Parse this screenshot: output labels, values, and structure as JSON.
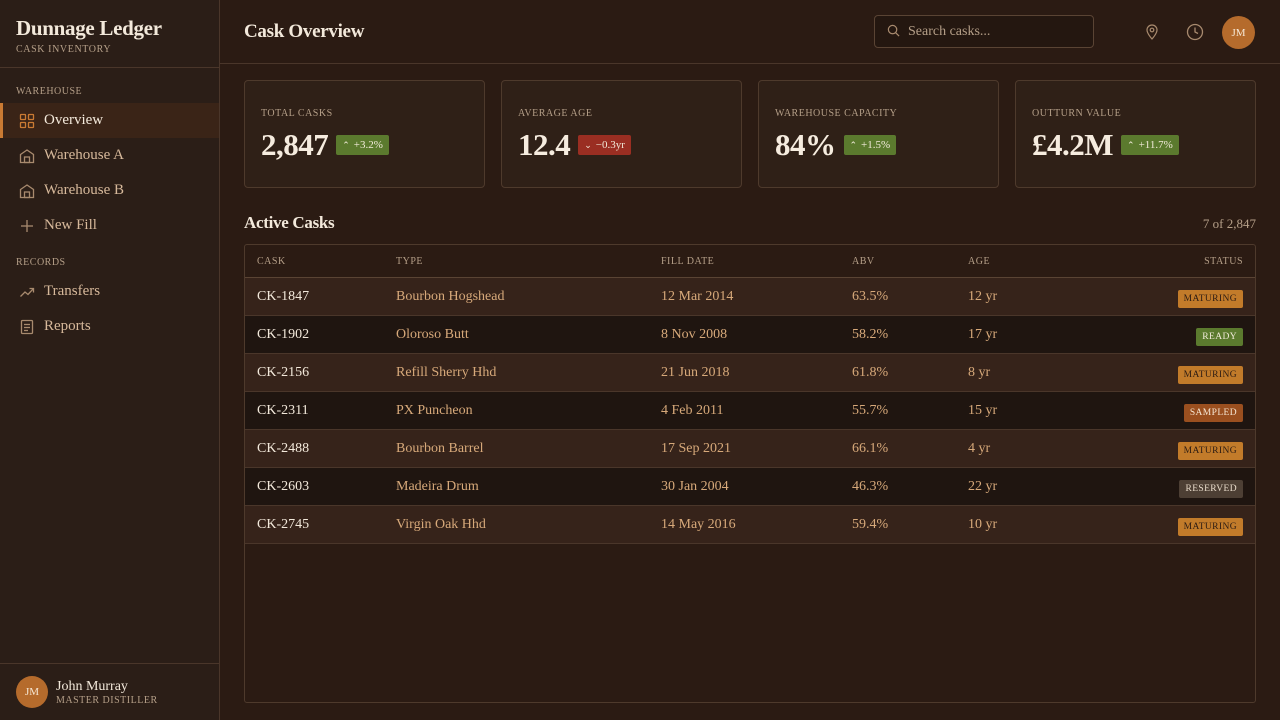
{
  "brand": {
    "title": "Dunnage Ledger",
    "subtitle": "Cask Inventory"
  },
  "sidebar": {
    "sections": [
      {
        "label": "Warehouse"
      },
      {
        "label": "Records"
      }
    ],
    "items": [
      {
        "label": "Overview",
        "icon": "grid-icon"
      },
      {
        "label": "Warehouse A",
        "icon": "warehouse-icon"
      },
      {
        "label": "Warehouse B",
        "icon": "warehouse-icon"
      },
      {
        "label": "New Fill",
        "icon": "plus-icon"
      },
      {
        "label": "Transfers",
        "icon": "trend-icon"
      },
      {
        "label": "Reports",
        "icon": "document-icon"
      }
    ]
  },
  "user": {
    "initials": "JM",
    "name": "John Murray",
    "role": "Master Distiller"
  },
  "header": {
    "title": "Cask Overview",
    "search_placeholder": "Search casks...",
    "avatar_initials": "JM"
  },
  "kpis": [
    {
      "label": "Total Casks",
      "value": "2,847",
      "delta": "+3.2%",
      "direction": "up"
    },
    {
      "label": "Average Age",
      "value": "12.4",
      "delta": "−0.3yr",
      "direction": "down"
    },
    {
      "label": "Warehouse Capacity",
      "value": "84%",
      "delta": "+1.5%",
      "direction": "up"
    },
    {
      "label": "Outturn Value",
      "value": "£4.2M",
      "delta": "+11.7%",
      "direction": "up"
    }
  ],
  "table": {
    "title": "Active Casks",
    "count": "7 of 2,847",
    "headers": {
      "cask": "Cask",
      "type": "Type",
      "fill_date": "Fill Date",
      "abv": "ABV",
      "age": "Age",
      "status": "Status"
    },
    "rows": [
      {
        "cask": "CK-1847",
        "type": "Bourbon Hogshead",
        "fill_date": "12 Mar 2014",
        "abv": "63.5%",
        "age": "12 yr",
        "status": "Maturing"
      },
      {
        "cask": "CK-1902",
        "type": "Oloroso Butt",
        "fill_date": "8 Nov 2008",
        "abv": "58.2%",
        "age": "17 yr",
        "status": "Ready"
      },
      {
        "cask": "CK-2156",
        "type": "Refill Sherry Hhd",
        "fill_date": "21 Jun 2018",
        "abv": "61.8%",
        "age": "8 yr",
        "status": "Maturing"
      },
      {
        "cask": "CK-2311",
        "type": "PX Puncheon",
        "fill_date": "4 Feb 2011",
        "abv": "55.7%",
        "age": "15 yr",
        "status": "Sampled"
      },
      {
        "cask": "CK-2488",
        "type": "Bourbon Barrel",
        "fill_date": "17 Sep 2021",
        "abv": "66.1%",
        "age": "4 yr",
        "status": "Maturing"
      },
      {
        "cask": "CK-2603",
        "type": "Madeira Drum",
        "fill_date": "30 Jan 2004",
        "abv": "46.3%",
        "age": "22 yr",
        "status": "Reserved"
      },
      {
        "cask": "CK-2745",
        "type": "Virgin Oak Hhd",
        "fill_date": "14 May 2016",
        "abv": "59.4%",
        "age": "10 yr",
        "status": "Maturing"
      }
    ]
  },
  "colors": {
    "background": "#2b1b13",
    "accent": "#c97a33",
    "positive": "#5b7a2e",
    "negative": "#9a2e22",
    "text": "#f3e9db"
  }
}
